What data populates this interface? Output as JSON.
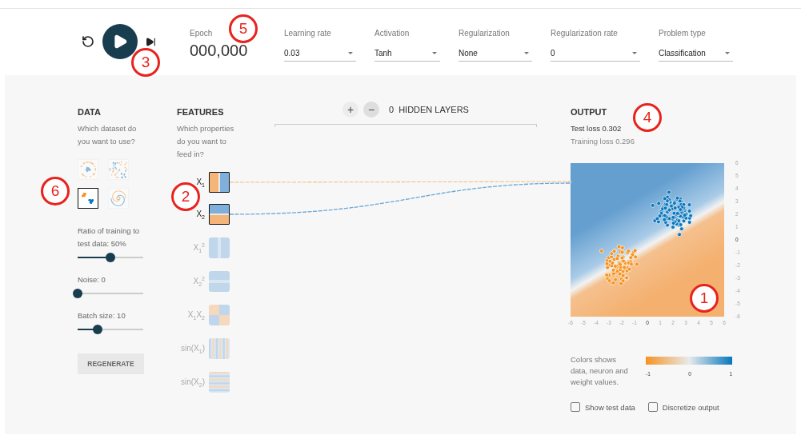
{
  "epoch": {
    "label": "Epoch",
    "value": "000,000"
  },
  "dropdowns": [
    {
      "label": "Learning rate",
      "value": "0.03"
    },
    {
      "label": "Activation",
      "value": "Tanh"
    },
    {
      "label": "Regularization",
      "value": "None"
    },
    {
      "label": "Regularization rate",
      "value": "0"
    },
    {
      "label": "Problem type",
      "value": "Classification"
    }
  ],
  "data": {
    "title": "DATA",
    "question": "Which dataset do you want to use?",
    "datasets": [
      {
        "kind": "circle",
        "selected": false
      },
      {
        "kind": "xor",
        "selected": false
      },
      {
        "kind": "gaussian",
        "selected": true
      },
      {
        "kind": "spiral",
        "selected": false
      }
    ],
    "sliders": [
      {
        "label": "Ratio of training to test data:  50%",
        "level": 0.5
      },
      {
        "label": "Noise:  0",
        "level": 0
      },
      {
        "label": "Batch size:  10",
        "level": 0.31
      }
    ],
    "button": "REGENERATE"
  },
  "features": {
    "title": "FEATURES",
    "question": "Which properties do you want to feed in?",
    "items": [
      {
        "label": "X$_{1}$",
        "kind": "x1",
        "selected": true
      },
      {
        "label": "X$_{2}$",
        "kind": "x2",
        "selected": true
      },
      {
        "label": "X$_{1}$$^{2}$",
        "kind": "x1sq",
        "selected": false
      },
      {
        "label": "X$_{2}$$^{2}$",
        "kind": "x2sq",
        "selected": false
      },
      {
        "label": "X$_{1}$X$_{2}$",
        "kind": "x1x2",
        "selected": false
      },
      {
        "label": "sin(X$_{1}$)",
        "kind": "sinx1",
        "selected": false
      },
      {
        "label": "sin(X$_{2}$)",
        "kind": "sinx2",
        "selected": false
      }
    ]
  },
  "network": {
    "add": "+",
    "remove": "−",
    "count": "0",
    "label": "HIDDEN LAYERS"
  },
  "output": {
    "title": "OUTPUT",
    "test_loss": "Test loss 0.302",
    "training_loss": "Training loss 0.296",
    "y_ticks": [
      "6",
      "5",
      "4",
      "3",
      "2",
      "1",
      "0",
      "-1",
      "-2",
      "-3",
      "-4",
      "-5",
      "-6"
    ],
    "x_ticks": [
      "-6",
      "-5",
      "-4",
      "-3",
      "-2",
      "-1",
      "0",
      "1",
      "2",
      "3",
      "4",
      "5",
      "6"
    ],
    "legend": {
      "text": "Colors shows data, neuron and weight values.",
      "ticks": [
        "-1",
        "0",
        "1"
      ]
    },
    "checkboxes": [
      {
        "label": "Show test data",
        "checked": false
      },
      {
        "label": "Discretize output",
        "checked": false
      }
    ]
  },
  "annotations": [
    "5",
    "3",
    "4",
    "2",
    "6",
    "1"
  ]
}
